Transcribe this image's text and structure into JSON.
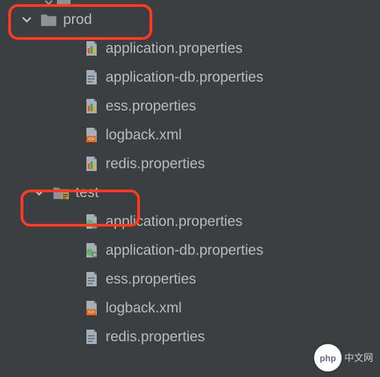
{
  "tree": {
    "row0": {
      "label": ""
    },
    "folders": [
      {
        "name": "prod",
        "expanded": true,
        "files": [
          {
            "name": "application.properties",
            "icon": "props-chart"
          },
          {
            "name": "application-db.properties",
            "icon": "props-plain"
          },
          {
            "name": "ess.properties",
            "icon": "props-chart"
          },
          {
            "name": "logback.xml",
            "icon": "xml"
          },
          {
            "name": "redis.properties",
            "icon": "props-chart"
          }
        ]
      },
      {
        "name": "test",
        "expanded": true,
        "files": [
          {
            "name": "application.properties",
            "icon": "props-gear"
          },
          {
            "name": "application-db.properties",
            "icon": "props-gear"
          },
          {
            "name": "ess.properties",
            "icon": "props-plain"
          },
          {
            "name": "logback.xml",
            "icon": "xml"
          },
          {
            "name": "redis.properties",
            "icon": "props-plain"
          }
        ]
      }
    ]
  },
  "watermark": {
    "badge": "php",
    "text": "中文网"
  }
}
